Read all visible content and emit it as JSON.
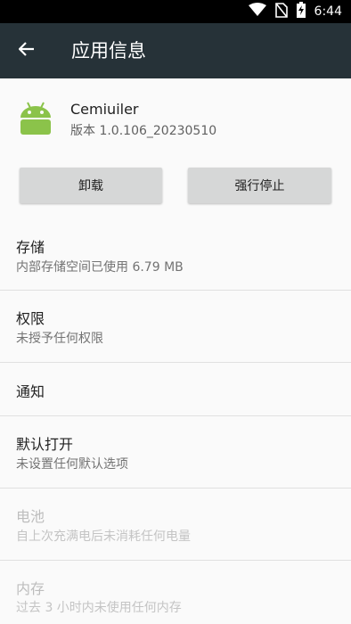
{
  "status_bar": {
    "time": "6:44",
    "icons": [
      "wifi-icon",
      "no-sim-icon",
      "battery-charging-icon"
    ]
  },
  "app_bar": {
    "title": "应用信息",
    "back_icon": "arrow-back-icon"
  },
  "app": {
    "name": "Cemiuiler",
    "version": "版本 1.0.106_20230510",
    "icon": "android-robot-icon",
    "icon_color": "#8bc34a"
  },
  "buttons": {
    "uninstall": "卸载",
    "force_stop": "强行停止"
  },
  "items": [
    {
      "title": "存储",
      "subtitle": "内部存储空间已使用 6.79 MB",
      "enabled": true
    },
    {
      "title": "权限",
      "subtitle": "未授予任何权限",
      "enabled": true
    },
    {
      "title": "通知",
      "subtitle": "",
      "enabled": true
    },
    {
      "title": "默认打开",
      "subtitle": "未设置任何默认选项",
      "enabled": true
    },
    {
      "title": "电池",
      "subtitle": "自上次充满电后未消耗任何电量",
      "enabled": false
    },
    {
      "title": "内存",
      "subtitle": "过去 3 小时内未使用任何内存",
      "enabled": false
    }
  ],
  "colors": {
    "app_bar": "#263238",
    "status_bar": "#000000",
    "background": "#fafafa",
    "button": "#d6d7d7"
  }
}
